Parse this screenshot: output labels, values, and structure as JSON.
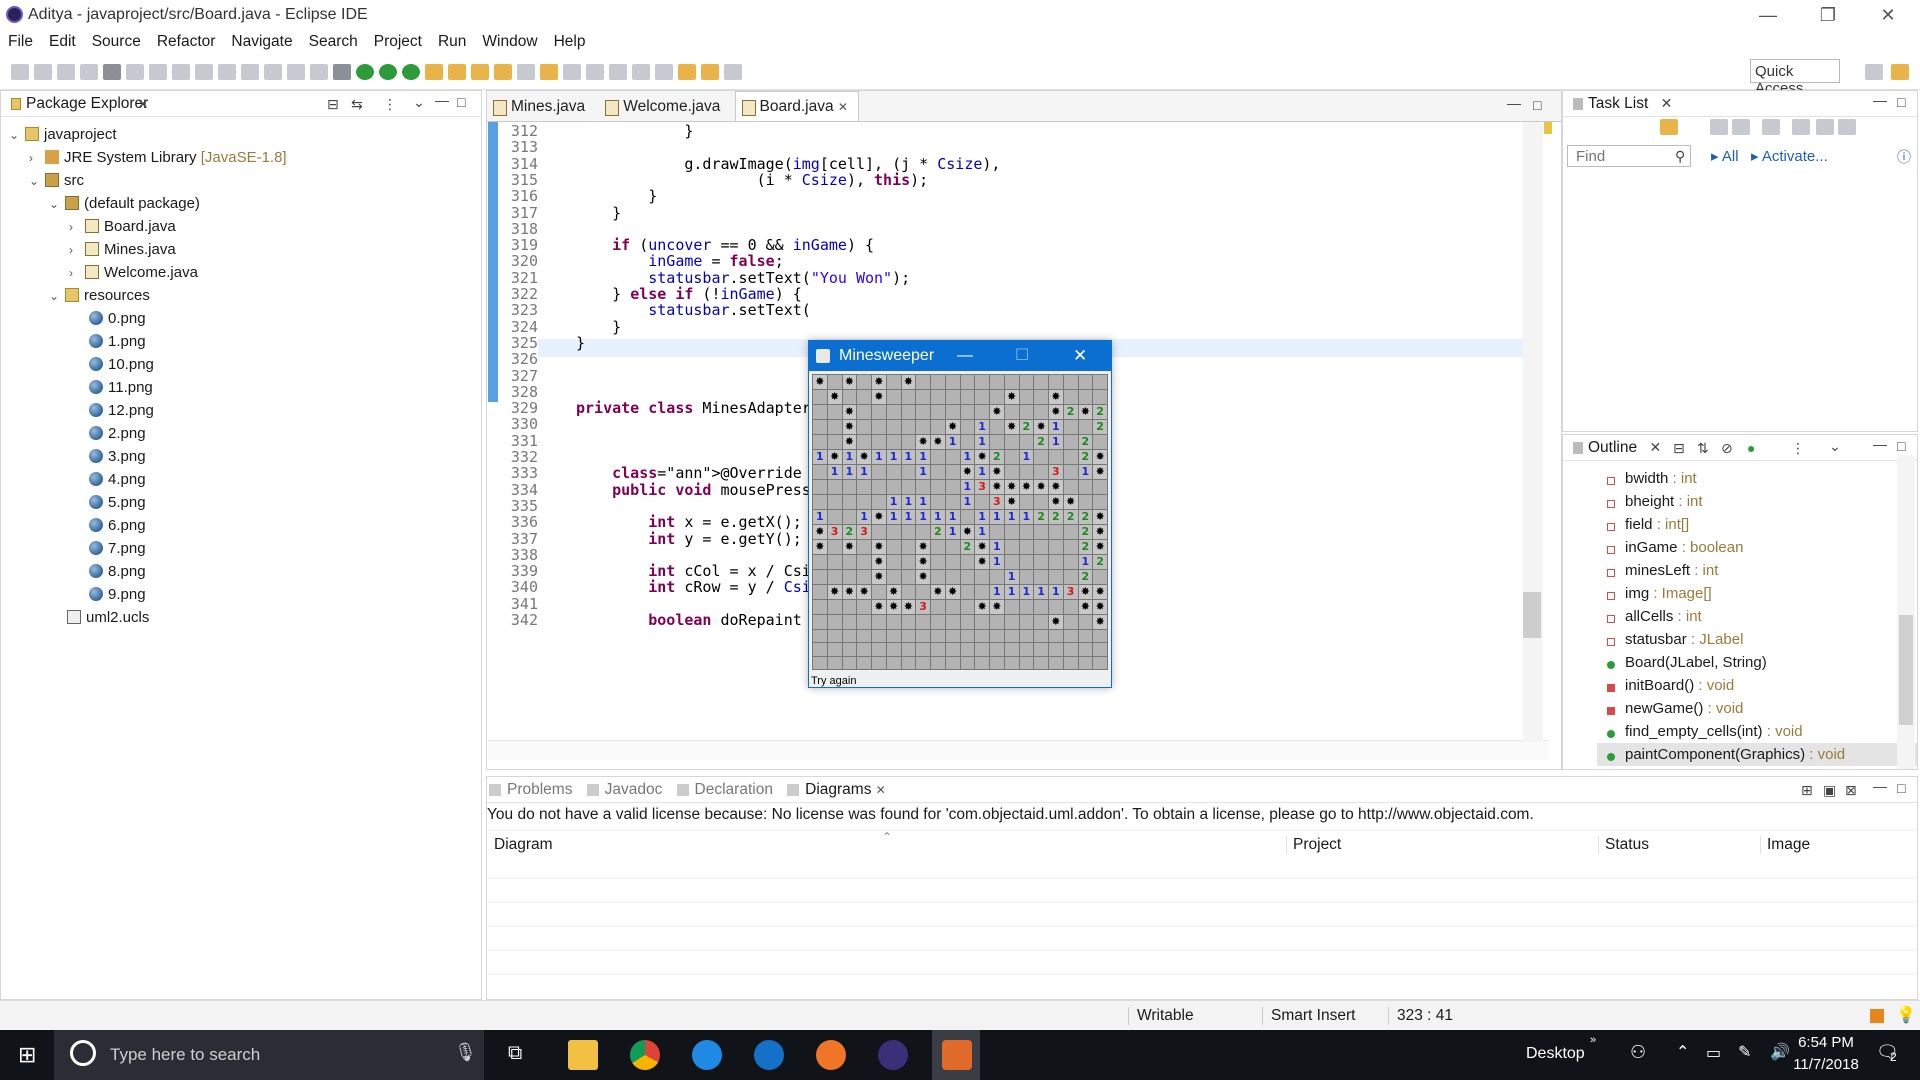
{
  "window": {
    "title": "Aditya - javaproject/src/Board.java - Eclipse IDE",
    "minimize": "—",
    "restore": "❐",
    "close": "✕"
  },
  "menu": [
    "File",
    "Edit",
    "Source",
    "Refactor",
    "Navigate",
    "Search",
    "Project",
    "Run",
    "Window",
    "Help"
  ],
  "toolbar": {
    "quick_access": "Quick Access"
  },
  "package_explorer": {
    "title": "Package Explorer",
    "items": [
      {
        "label": "javaproject"
      },
      {
        "label": "JRE System Library",
        "suffix": "[JavaSE-1.8]"
      },
      {
        "label": "src"
      },
      {
        "label": "(default package)"
      },
      {
        "label": "Board.java"
      },
      {
        "label": "Mines.java"
      },
      {
        "label": "Welcome.java"
      },
      {
        "label": "resources"
      },
      {
        "label": "0.png"
      },
      {
        "label": "1.png"
      },
      {
        "label": "10.png"
      },
      {
        "label": "11.png"
      },
      {
        "label": "12.png"
      },
      {
        "label": "2.png"
      },
      {
        "label": "3.png"
      },
      {
        "label": "4.png"
      },
      {
        "label": "5.png"
      },
      {
        "label": "6.png"
      },
      {
        "label": "7.png"
      },
      {
        "label": "8.png"
      },
      {
        "label": "9.png"
      },
      {
        "label": "uml2.ucls"
      }
    ]
  },
  "editor": {
    "tabs": [
      "Mines.java",
      "Welcome.java",
      "Board.java"
    ],
    "active_tab": "Board.java",
    "lines": [
      {
        "n": "312",
        "code": "            }"
      },
      {
        "n": "313",
        "code": ""
      },
      {
        "n": "314",
        "code": "            g.drawImage(img[cell], (j * Csize),"
      },
      {
        "n": "315",
        "code": "                    (i * Csize), this);"
      },
      {
        "n": "316",
        "code": "        }"
      },
      {
        "n": "317",
        "code": "    }"
      },
      {
        "n": "318",
        "code": ""
      },
      {
        "n": "319",
        "code": "    if (uncover == 0 && inGame) {"
      },
      {
        "n": "320",
        "code": "        inGame = false;"
      },
      {
        "n": "321",
        "code": "        statusbar.setText(\"You Won\");"
      },
      {
        "n": "322",
        "code": "    } else if (!inGame) {"
      },
      {
        "n": "323",
        "code": "        statusbar.setText("
      },
      {
        "n": "324",
        "code": "    }"
      },
      {
        "n": "325",
        "code": "}"
      },
      {
        "n": "326",
        "code": ""
      },
      {
        "n": "327",
        "code": ""
      },
      {
        "n": "328",
        "code": ""
      },
      {
        "n": "329",
        "code": "private class MinesAdapter"
      },
      {
        "n": "330",
        "code": ""
      },
      {
        "n": "331",
        "code": ""
      },
      {
        "n": "332",
        "code": ""
      },
      {
        "n": "333",
        "code": "    @Override"
      },
      {
        "n": "334",
        "code": "    public void mousePress"
      },
      {
        "n": "335",
        "code": ""
      },
      {
        "n": "336",
        "code": "        int x = e.getX();"
      },
      {
        "n": "337",
        "code": "        int y = e.getY();"
      },
      {
        "n": "338",
        "code": ""
      },
      {
        "n": "339",
        "code": "        int cCol = x / Csi"
      },
      {
        "n": "340",
        "code": "        int cRow = y / Csize;"
      },
      {
        "n": "341",
        "code": ""
      },
      {
        "n": "342",
        "code": "        boolean doRepaint = false;"
      }
    ]
  },
  "minesweeper": {
    "title": "Minesweeper",
    "status": "Try again",
    "board": [
      "MRMRMRMRRRRRRRRRRRRR",
      "RMRRMRRRRRRRRMRRMRRR",
      "RRMRRRRRRRRRMRRRM2M2",
      "RRMRRRRRRMR1RM2M1RR2",
      "RRMRRRRMM1R1RRR21R2R",
      "1M1M1111RR1M2R1RRR2M",
      "R111RRR1RRM1MRRR3R1M",
      "RRRRRRRRRR13MMMMMRRR",
      "RRRRR111RR1R3MRRMMR",
      "1RR1M11111R11112222M",
      "M323RRRR21M1RRRRRR2M",
      "MRMRMRRMRR2M1RRRRR2M",
      "RRRRMRRMRRRM1RRRRR12",
      "RRRRMRRMRRRRR1RRRR2R",
      "RMMMRMRRMMRR111113MM",
      "RRRRMMM3RRRMMRRRRRMM",
      "RRRRRRRRRRRRRRRRMRRM",
      "RRRRRRRRRRRRRRRRRRRR",
      "RRRRRRRRRRRRRRRRRRRR",
      "RRRRRRRRRRRRRRRRRRRR"
    ]
  },
  "task_list": {
    "title": "Task List",
    "find_placeholder": "Find",
    "all": "All",
    "activate": "Activate..."
  },
  "outline": {
    "title": "Outline",
    "items": [
      {
        "name": "bwidth",
        "type": ": int",
        "kind": "field-final"
      },
      {
        "name": "bheight",
        "type": ": int",
        "kind": "field-final"
      },
      {
        "name": "field",
        "type": ": int[]",
        "kind": "field"
      },
      {
        "name": "inGame",
        "type": ": boolean",
        "kind": "field"
      },
      {
        "name": "minesLeft",
        "type": ": int",
        "kind": "field"
      },
      {
        "name": "img",
        "type": ": Image[]",
        "kind": "field"
      },
      {
        "name": "allCells",
        "type": ": int",
        "kind": "field"
      },
      {
        "name": "statusbar",
        "type": ": JLabel",
        "kind": "field-final"
      },
      {
        "name": "Board(JLabel, String)",
        "type": "",
        "kind": "ctor"
      },
      {
        "name": "initBoard()",
        "type": ": void",
        "kind": "private-method"
      },
      {
        "name": "newGame()",
        "type": ": void",
        "kind": "private-method"
      },
      {
        "name": "find_empty_cells(int)",
        "type": ": void",
        "kind": "method"
      },
      {
        "name": "paintComponent(Graphics)",
        "type": ": void",
        "kind": "method"
      }
    ]
  },
  "bottom_panel": {
    "tabs": [
      "Problems",
      "Javadoc",
      "Declaration",
      "Diagrams"
    ],
    "active_tab": "Diagrams",
    "license_msg": "You do not have a valid license because: No license was found for 'com.objectaid.uml.addon'. To obtain a license, please go to http://www.objectaid.com.",
    "columns": [
      "Diagram",
      "Project",
      "Status",
      "Image"
    ]
  },
  "status_bar": {
    "writable": "Writable",
    "insert_mode": "Smart Insert",
    "position": "323 : 41"
  },
  "taskbar": {
    "search_placeholder": "Type here to search",
    "desktop": "Desktop",
    "time": "6:54 PM",
    "date": "11/7/2018",
    "notifications": "2"
  }
}
